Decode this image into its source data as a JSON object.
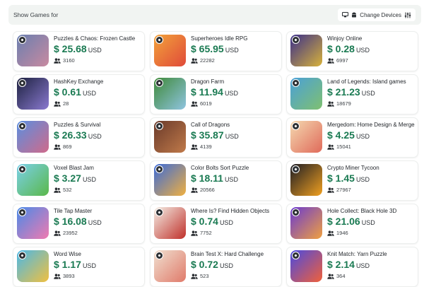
{
  "filter": {
    "label": "Show Games for",
    "change_devices_label": "Change Devices",
    "device_icons": [
      "monitor-icon",
      "android-icon",
      "sliders-icon"
    ]
  },
  "currency": "USD",
  "games": [
    {
      "title": "Puzzles & Chaos: Frozen Castle",
      "price": "$ 25.68",
      "players": "3160",
      "c1": "#6a7fb0",
      "c2": "#c98aa0"
    },
    {
      "title": "Superheroes Idle RPG",
      "price": "$ 65.95",
      "players": "22282",
      "c1": "#f2a23a",
      "c2": "#e04a3a"
    },
    {
      "title": "Winjoy Online",
      "price": "$ 0.28",
      "players": "6997",
      "c1": "#3a2f8a",
      "c2": "#d8b23a"
    },
    {
      "title": "HashKey Exchange",
      "price": "$ 0.61",
      "players": "28",
      "c1": "#1d2140",
      "c2": "#8a7ad0"
    },
    {
      "title": "Dragon Farm",
      "price": "$ 11.94",
      "players": "6019",
      "c1": "#3f8a3a",
      "c2": "#8fc4e0"
    },
    {
      "title": "Land of Legends: Island games",
      "price": "$ 21.23",
      "players": "18679",
      "c1": "#4aa0d8",
      "c2": "#7fc070"
    },
    {
      "title": "Puzzles & Survival",
      "price": "$ 26.33",
      "players": "869",
      "c1": "#5a8fe0",
      "c2": "#d06a8a"
    },
    {
      "title": "Call of Dragons",
      "price": "$ 35.87",
      "players": "4139",
      "c1": "#6a3a2a",
      "c2": "#c07a4a"
    },
    {
      "title": "Mergedom: Home Design & Merge",
      "price": "$ 4.25",
      "players": "15041",
      "c1": "#f4d9b0",
      "c2": "#e06a5a"
    },
    {
      "title": "Voxel Blast Jam",
      "price": "$ 3.27",
      "players": "532",
      "c1": "#7ad0e8",
      "c2": "#5ab84a"
    },
    {
      "title": "Color Bolts Sort Puzzle",
      "price": "$ 18.11",
      "players": "20566",
      "c1": "#3a6ad8",
      "c2": "#f0b040"
    },
    {
      "title": "Crypto Miner Tycoon",
      "price": "$ 1.45",
      "players": "27967",
      "c1": "#1c1c24",
      "c2": "#f0a020"
    },
    {
      "title": "Tile Tap Master",
      "price": "$ 16.08",
      "players": "23952",
      "c1": "#4a8ae8",
      "c2": "#f07ab0"
    },
    {
      "title": "Where Is? Find Hidden Objects",
      "price": "$ 0.74",
      "players": "7752",
      "c1": "#f4efe6",
      "c2": "#c0302a"
    },
    {
      "title": "Hole Collect: Black Hole 3D",
      "price": "$ 21.06",
      "players": "1946",
      "c1": "#6a3ad0",
      "c2": "#f0a040"
    },
    {
      "title": "Word Wise",
      "price": "$ 1.17",
      "players": "3893",
      "c1": "#4ab8e8",
      "c2": "#f0c040"
    },
    {
      "title": "Brain Test X: Hard Challenge",
      "price": "$ 0.72",
      "players": "523",
      "c1": "#f0e0d0",
      "c2": "#e07a6a"
    },
    {
      "title": "Knit Match: Yarn Puzzle",
      "price": "$ 2.14",
      "players": "364",
      "c1": "#4a4ae0",
      "c2": "#f0603a"
    }
  ]
}
